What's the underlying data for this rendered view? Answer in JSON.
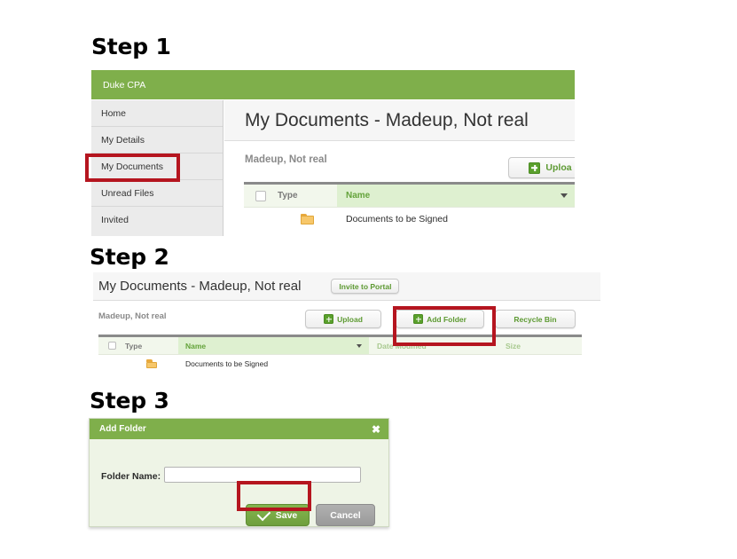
{
  "colors": {
    "brand_green": "#7FAF4B",
    "accent_green": "#5d9a32",
    "highlight_red": "#B5151F",
    "folder_yellow": "#f7c76a",
    "sidebar_grey": "#ebebeb"
  },
  "steps": [
    {
      "label": "Step 1"
    },
    {
      "label": "Step 2"
    },
    {
      "label": "Step 3"
    }
  ],
  "step1": {
    "brand": "Duke CPA",
    "sidebar": [
      {
        "label": "Home",
        "highlighted": false
      },
      {
        "label": "My Details",
        "highlighted": false
      },
      {
        "label": "My Documents",
        "highlighted": true
      },
      {
        "label": "Unread Files",
        "highlighted": false
      },
      {
        "label": "Invited",
        "highlighted": false
      }
    ],
    "page_title": "My Documents - Madeup, Not real",
    "breadcrumb": "Madeup, Not real",
    "upload_label": "Uploa",
    "table": {
      "columns": [
        "Type",
        "Name"
      ],
      "sorted_column": "Name",
      "rows": [
        {
          "type_icon": "folder-icon",
          "name": "Documents to be Signed"
        }
      ]
    }
  },
  "step2": {
    "page_title": "My Documents - Madeup, Not real",
    "invite_label": "Invite to Portal",
    "breadcrumb": "Madeup, Not real",
    "upload_label": "Upload",
    "add_folder_label": "Add Folder",
    "recycle_bin_label": "Recycle Bin",
    "table": {
      "columns": [
        "Type",
        "Name",
        "Date Modified",
        "Size"
      ],
      "sorted_column": "Name",
      "rows": [
        {
          "type_icon": "folder-icon",
          "name": "Documents to be Signed",
          "date_modified": "",
          "size": ""
        }
      ]
    }
  },
  "step3": {
    "dialog_title": "Add Folder",
    "close_label": "✖",
    "field_label": "Folder Name:",
    "field_value": "",
    "field_placeholder": "",
    "save_label": "Save",
    "cancel_label": "Cancel"
  }
}
